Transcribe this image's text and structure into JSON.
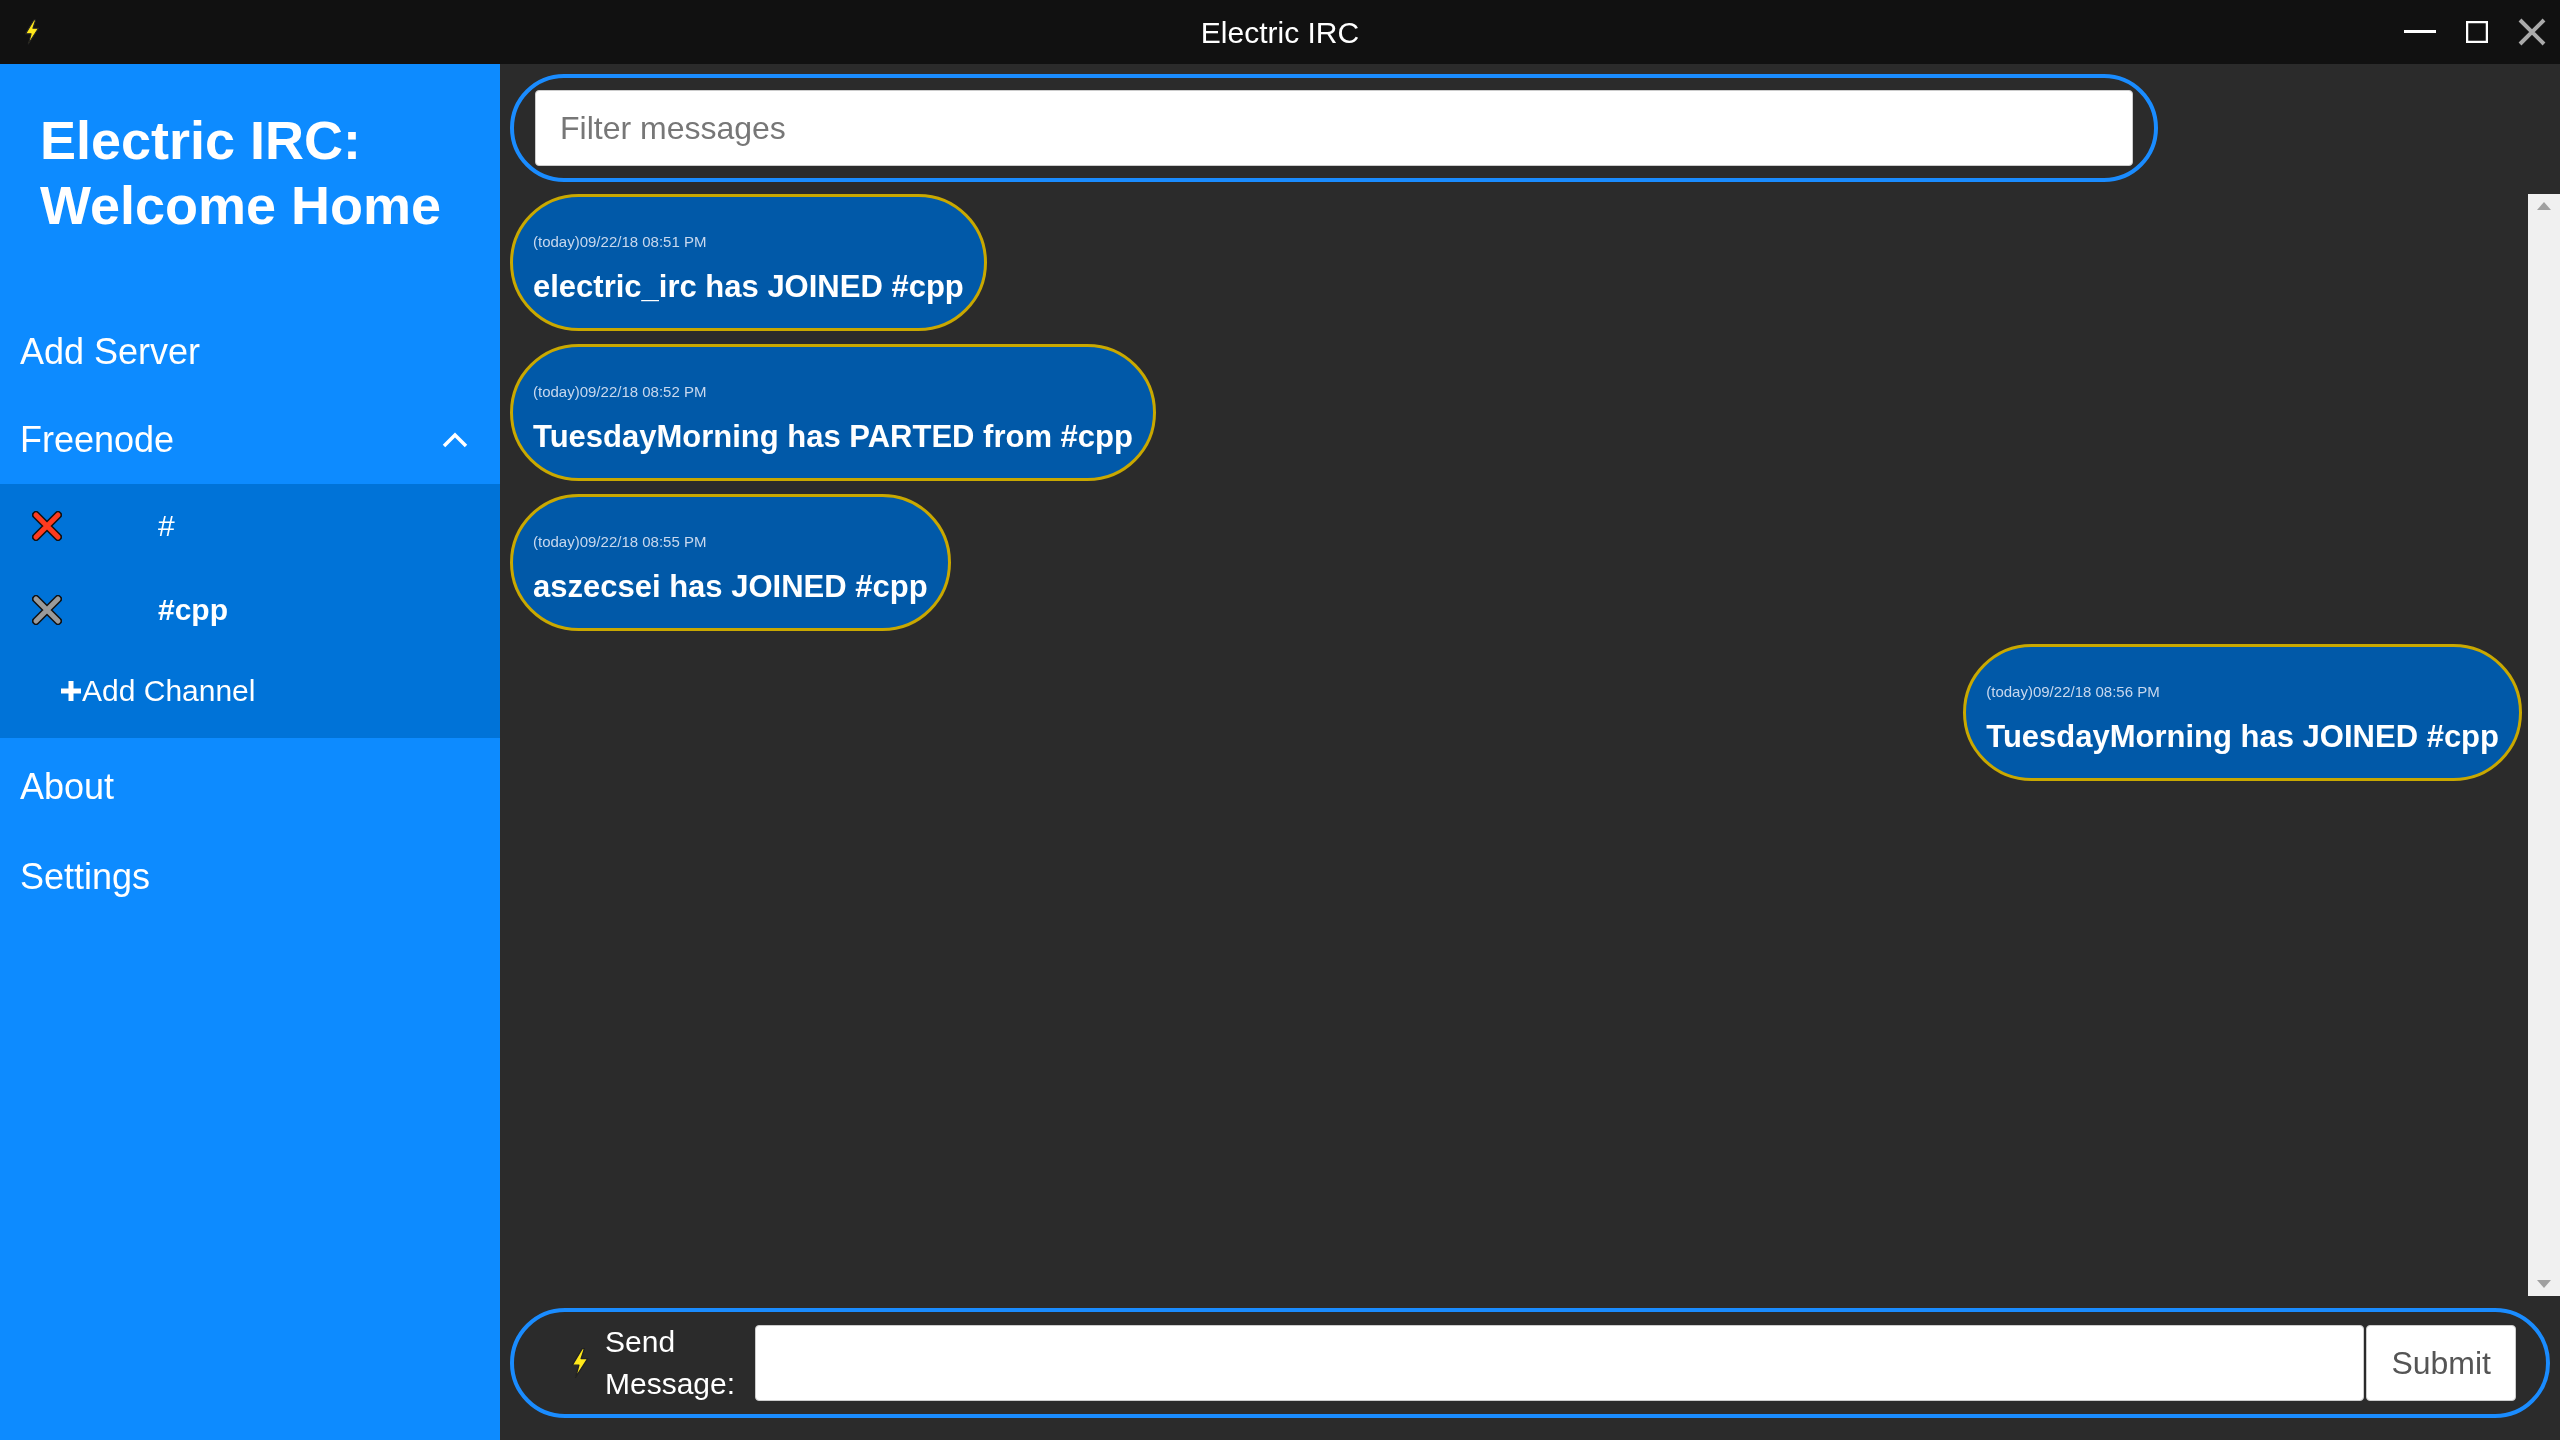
{
  "window": {
    "title": "Electric IRC"
  },
  "sidebar": {
    "heading": "Electric IRC: Welcome Home",
    "add_server": "Add Server",
    "servers": [
      {
        "name": "Freenode",
        "expanded": true,
        "channels": [
          {
            "name": "#",
            "selected": false,
            "color": "#ff3b1f"
          },
          {
            "name": "#cpp",
            "selected": true,
            "color": "#9a9a9a"
          }
        ],
        "add_channel": "Add Channel"
      }
    ],
    "items": [
      "About",
      "Settings"
    ]
  },
  "filter": {
    "placeholder": "Filter messages"
  },
  "messages": [
    {
      "time": "(today)09/22/18 08:51 PM",
      "text": "electric_irc has JOINED #cpp",
      "kind": "incoming"
    },
    {
      "time": "(today)09/22/18 08:52 PM",
      "text": "TuesdayMorning has PARTED from #cpp",
      "kind": "incoming"
    },
    {
      "time": "(today)09/22/18 08:55 PM",
      "text": "aszecsei has JOINED #cpp",
      "kind": "incoming"
    },
    {
      "time": "(today)09/22/18 08:56 PM",
      "text": "TuesdayMorning has JOINED #cpp",
      "kind": "outgoing"
    }
  ],
  "composer": {
    "label": "Send Message:",
    "button": "Submit"
  }
}
